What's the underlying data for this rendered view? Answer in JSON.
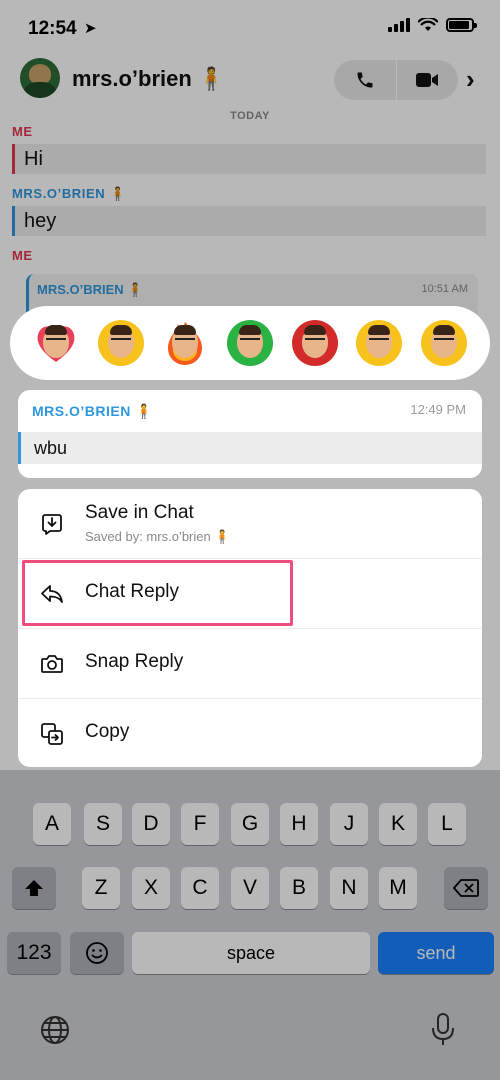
{
  "status_bar": {
    "time": "12:54",
    "location_arrow": "➤"
  },
  "header": {
    "name": "mrs.o’brien 🧍",
    "chevron": "›",
    "call_icon": "phone-icon",
    "video_icon": "video-icon"
  },
  "chat": {
    "day_label": "TODAY",
    "messages": [
      {
        "sender": "ME",
        "text": "Hi"
      },
      {
        "sender": "MRS.O’BRIEN 🧍",
        "text": "hey"
      },
      {
        "sender": "ME"
      }
    ],
    "quoted": {
      "name": "MRS.O’BRIEN 🧍",
      "time": "10:51 AM"
    }
  },
  "reactions": [
    {
      "name": "heart-bitmoji",
      "bg": "#ffffff",
      "accent": "#e8405a"
    },
    {
      "name": "laughing-bitmoji",
      "bg": "#f6c21b",
      "accent": "#f6c21b"
    },
    {
      "name": "fire-bitmoji",
      "bg": "#f45a1e",
      "accent": "#ffb21d"
    },
    {
      "name": "thumbs-up-bitmoji",
      "bg": "#2ab342",
      "accent": "#2ab342"
    },
    {
      "name": "thumbs-down-bitmoji",
      "bg": "#d32a2a",
      "accent": "#d32a2a"
    },
    {
      "name": "crying-bitmoji",
      "bg": "#f6c21b",
      "accent": "#4aa7ef"
    },
    {
      "name": "shocked-bitmoji",
      "bg": "#f6c21b",
      "accent": "#f6c21b"
    }
  ],
  "selected_message": {
    "sender": "MRS.O’BRIEN 🧍",
    "time": "12:49 PM",
    "text": "wbu"
  },
  "menu": {
    "save": {
      "label": "Save in Chat",
      "sub": "Saved by: mrs.o’brien 🧍"
    },
    "chat_reply": {
      "label": "Chat Reply"
    },
    "snap_reply": {
      "label": "Snap Reply"
    },
    "copy": {
      "label": "Copy"
    }
  },
  "keyboard": {
    "row2": [
      "A",
      "S",
      "D",
      "F",
      "G",
      "H",
      "J",
      "K",
      "L"
    ],
    "row3": [
      "Z",
      "X",
      "C",
      "V",
      "B",
      "N",
      "M"
    ],
    "numbers": "123",
    "space": "space",
    "send": "send"
  },
  "colors": {
    "me": "#e2384f",
    "friend": "#2f98dd",
    "highlight": "#ef4d7d",
    "send": "#1a82ff"
  }
}
